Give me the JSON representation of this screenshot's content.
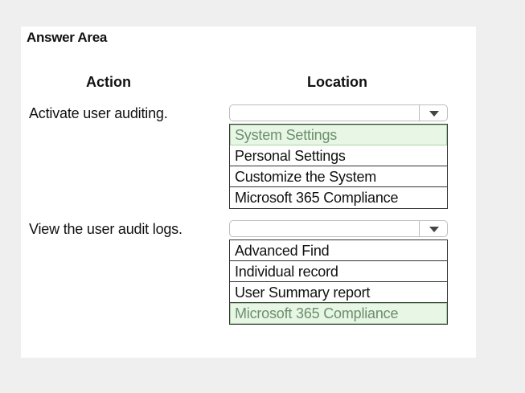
{
  "answer_area": {
    "title": "Answer Area",
    "headers": {
      "action": "Action",
      "location": "Location"
    },
    "rows": [
      {
        "action": "Activate user auditing.",
        "options": [
          {
            "label": "System Settings",
            "selected": true
          },
          {
            "label": "Personal Settings",
            "selected": false
          },
          {
            "label": "Customize the System",
            "selected": false
          },
          {
            "label": "Microsoft 365 Compliance",
            "selected": false
          }
        ]
      },
      {
        "action": "View the user audit logs.",
        "options": [
          {
            "label": "Advanced Find",
            "selected": false
          },
          {
            "label": "Individual record",
            "selected": false
          },
          {
            "label": "User Summary report",
            "selected": false
          },
          {
            "label": "Microsoft 365 Compliance",
            "selected": true
          }
        ]
      }
    ],
    "colors": {
      "selected_bg": "#e8f6e6",
      "selected_text": "#6b8f6b",
      "page_bg": "#efefef",
      "panel_bg": "#ffffff"
    },
    "icons": [
      "chevron-down-icon"
    ]
  }
}
